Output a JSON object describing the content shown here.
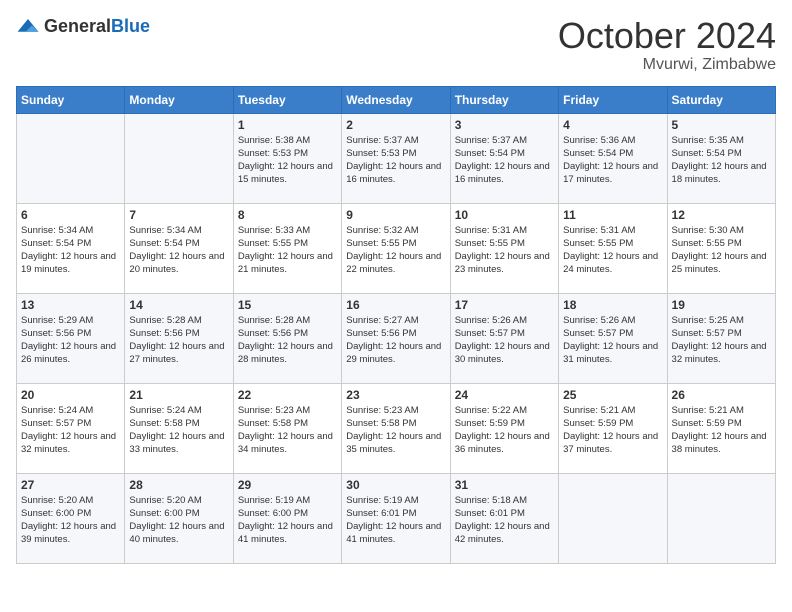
{
  "logo": {
    "general": "General",
    "blue": "Blue"
  },
  "header": {
    "month": "October 2024",
    "location": "Mvurwi, Zimbabwe"
  },
  "weekdays": [
    "Sunday",
    "Monday",
    "Tuesday",
    "Wednesday",
    "Thursday",
    "Friday",
    "Saturday"
  ],
  "weeks": [
    [
      {
        "day": "",
        "sunrise": "",
        "sunset": "",
        "daylight": ""
      },
      {
        "day": "",
        "sunrise": "",
        "sunset": "",
        "daylight": ""
      },
      {
        "day": "1",
        "sunrise": "Sunrise: 5:38 AM",
        "sunset": "Sunset: 5:53 PM",
        "daylight": "Daylight: 12 hours and 15 minutes."
      },
      {
        "day": "2",
        "sunrise": "Sunrise: 5:37 AM",
        "sunset": "Sunset: 5:53 PM",
        "daylight": "Daylight: 12 hours and 16 minutes."
      },
      {
        "day": "3",
        "sunrise": "Sunrise: 5:37 AM",
        "sunset": "Sunset: 5:54 PM",
        "daylight": "Daylight: 12 hours and 16 minutes."
      },
      {
        "day": "4",
        "sunrise": "Sunrise: 5:36 AM",
        "sunset": "Sunset: 5:54 PM",
        "daylight": "Daylight: 12 hours and 17 minutes."
      },
      {
        "day": "5",
        "sunrise": "Sunrise: 5:35 AM",
        "sunset": "Sunset: 5:54 PM",
        "daylight": "Daylight: 12 hours and 18 minutes."
      }
    ],
    [
      {
        "day": "6",
        "sunrise": "Sunrise: 5:34 AM",
        "sunset": "Sunset: 5:54 PM",
        "daylight": "Daylight: 12 hours and 19 minutes."
      },
      {
        "day": "7",
        "sunrise": "Sunrise: 5:34 AM",
        "sunset": "Sunset: 5:54 PM",
        "daylight": "Daylight: 12 hours and 20 minutes."
      },
      {
        "day": "8",
        "sunrise": "Sunrise: 5:33 AM",
        "sunset": "Sunset: 5:55 PM",
        "daylight": "Daylight: 12 hours and 21 minutes."
      },
      {
        "day": "9",
        "sunrise": "Sunrise: 5:32 AM",
        "sunset": "Sunset: 5:55 PM",
        "daylight": "Daylight: 12 hours and 22 minutes."
      },
      {
        "day": "10",
        "sunrise": "Sunrise: 5:31 AM",
        "sunset": "Sunset: 5:55 PM",
        "daylight": "Daylight: 12 hours and 23 minutes."
      },
      {
        "day": "11",
        "sunrise": "Sunrise: 5:31 AM",
        "sunset": "Sunset: 5:55 PM",
        "daylight": "Daylight: 12 hours and 24 minutes."
      },
      {
        "day": "12",
        "sunrise": "Sunrise: 5:30 AM",
        "sunset": "Sunset: 5:55 PM",
        "daylight": "Daylight: 12 hours and 25 minutes."
      }
    ],
    [
      {
        "day": "13",
        "sunrise": "Sunrise: 5:29 AM",
        "sunset": "Sunset: 5:56 PM",
        "daylight": "Daylight: 12 hours and 26 minutes."
      },
      {
        "day": "14",
        "sunrise": "Sunrise: 5:28 AM",
        "sunset": "Sunset: 5:56 PM",
        "daylight": "Daylight: 12 hours and 27 minutes."
      },
      {
        "day": "15",
        "sunrise": "Sunrise: 5:28 AM",
        "sunset": "Sunset: 5:56 PM",
        "daylight": "Daylight: 12 hours and 28 minutes."
      },
      {
        "day": "16",
        "sunrise": "Sunrise: 5:27 AM",
        "sunset": "Sunset: 5:56 PM",
        "daylight": "Daylight: 12 hours and 29 minutes."
      },
      {
        "day": "17",
        "sunrise": "Sunrise: 5:26 AM",
        "sunset": "Sunset: 5:57 PM",
        "daylight": "Daylight: 12 hours and 30 minutes."
      },
      {
        "day": "18",
        "sunrise": "Sunrise: 5:26 AM",
        "sunset": "Sunset: 5:57 PM",
        "daylight": "Daylight: 12 hours and 31 minutes."
      },
      {
        "day": "19",
        "sunrise": "Sunrise: 5:25 AM",
        "sunset": "Sunset: 5:57 PM",
        "daylight": "Daylight: 12 hours and 32 minutes."
      }
    ],
    [
      {
        "day": "20",
        "sunrise": "Sunrise: 5:24 AM",
        "sunset": "Sunset: 5:57 PM",
        "daylight": "Daylight: 12 hours and 32 minutes."
      },
      {
        "day": "21",
        "sunrise": "Sunrise: 5:24 AM",
        "sunset": "Sunset: 5:58 PM",
        "daylight": "Daylight: 12 hours and 33 minutes."
      },
      {
        "day": "22",
        "sunrise": "Sunrise: 5:23 AM",
        "sunset": "Sunset: 5:58 PM",
        "daylight": "Daylight: 12 hours and 34 minutes."
      },
      {
        "day": "23",
        "sunrise": "Sunrise: 5:23 AM",
        "sunset": "Sunset: 5:58 PM",
        "daylight": "Daylight: 12 hours and 35 minutes."
      },
      {
        "day": "24",
        "sunrise": "Sunrise: 5:22 AM",
        "sunset": "Sunset: 5:59 PM",
        "daylight": "Daylight: 12 hours and 36 minutes."
      },
      {
        "day": "25",
        "sunrise": "Sunrise: 5:21 AM",
        "sunset": "Sunset: 5:59 PM",
        "daylight": "Daylight: 12 hours and 37 minutes."
      },
      {
        "day": "26",
        "sunrise": "Sunrise: 5:21 AM",
        "sunset": "Sunset: 5:59 PM",
        "daylight": "Daylight: 12 hours and 38 minutes."
      }
    ],
    [
      {
        "day": "27",
        "sunrise": "Sunrise: 5:20 AM",
        "sunset": "Sunset: 6:00 PM",
        "daylight": "Daylight: 12 hours and 39 minutes."
      },
      {
        "day": "28",
        "sunrise": "Sunrise: 5:20 AM",
        "sunset": "Sunset: 6:00 PM",
        "daylight": "Daylight: 12 hours and 40 minutes."
      },
      {
        "day": "29",
        "sunrise": "Sunrise: 5:19 AM",
        "sunset": "Sunset: 6:00 PM",
        "daylight": "Daylight: 12 hours and 41 minutes."
      },
      {
        "day": "30",
        "sunrise": "Sunrise: 5:19 AM",
        "sunset": "Sunset: 6:01 PM",
        "daylight": "Daylight: 12 hours and 41 minutes."
      },
      {
        "day": "31",
        "sunrise": "Sunrise: 5:18 AM",
        "sunset": "Sunset: 6:01 PM",
        "daylight": "Daylight: 12 hours and 42 minutes."
      },
      {
        "day": "",
        "sunrise": "",
        "sunset": "",
        "daylight": ""
      },
      {
        "day": "",
        "sunrise": "",
        "sunset": "",
        "daylight": ""
      }
    ]
  ]
}
